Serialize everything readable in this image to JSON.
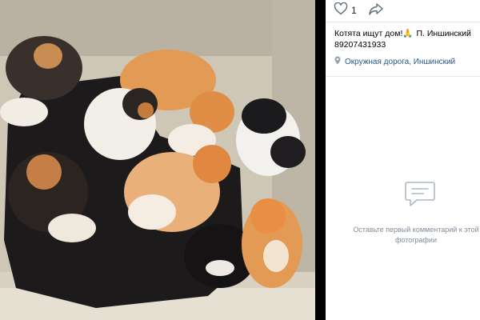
{
  "photo": {
    "alt": "Котята"
  },
  "actions": {
    "like_count": "1"
  },
  "post": {
    "title": "Котята ищут дом!🙏",
    "author": "П. Иншинский",
    "phone": "89207431933"
  },
  "location": {
    "text": "Окружная дорога, Иншинский"
  },
  "comments": {
    "empty_text": "Оставьте первый комментарий к этой фотографии"
  },
  "colors": {
    "link": "#2a5885",
    "muted": "#818c99",
    "divider": "#e7e8ec"
  }
}
